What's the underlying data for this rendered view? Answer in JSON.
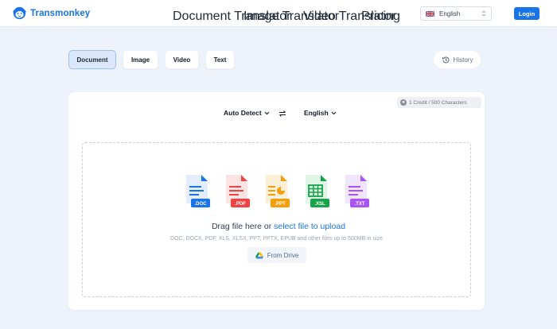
{
  "brand": {
    "name": "Transmonkey"
  },
  "nav": {
    "items": [
      {
        "label": "Document Translator"
      },
      {
        "label": "Image Translator"
      },
      {
        "label": "Video Translator"
      },
      {
        "label": "Pricing"
      }
    ]
  },
  "language_select": {
    "value": "English"
  },
  "login": {
    "label": "Login"
  },
  "tabs": [
    {
      "label": "Document",
      "active": true
    },
    {
      "label": "Image",
      "active": false
    },
    {
      "label": "Video",
      "active": false
    },
    {
      "label": "Text",
      "active": false
    }
  ],
  "history": {
    "label": "History"
  },
  "credit": {
    "text": "1 Credit / 500 Characters"
  },
  "source_lang": {
    "label": "Auto Detect"
  },
  "target_lang": {
    "label": "English"
  },
  "file_types": [
    {
      "label": ".DOC",
      "color": "#1a73e8"
    },
    {
      "label": ".PDF",
      "color": "#ef4444"
    },
    {
      "label": ".PPT",
      "color": "#f59e0b"
    },
    {
      "label": ".XSL",
      "color": "#16a34a"
    },
    {
      "label": ".TXT",
      "color": "#a855f7"
    }
  ],
  "dropzone": {
    "title_prefix": "Drag file here or ",
    "title_link": "select file to upload",
    "subtitle": "DOC, DOCX, PDF, XLS, XLSX, PPT, PPTX, EPUB and other files up to 500MB in size",
    "drive_label": "From Drive"
  },
  "colors": {
    "accent": "#1a73e8",
    "background": "#eef3fb"
  }
}
